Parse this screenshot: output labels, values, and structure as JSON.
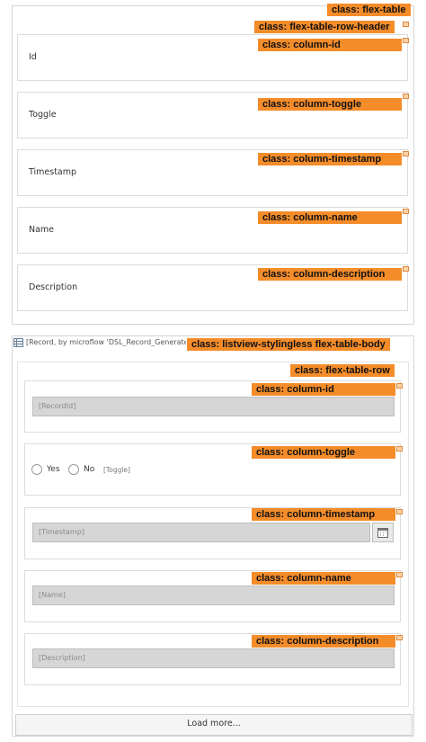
{
  "header_table": {
    "tag": "class: flex-table",
    "row_tag": "class: flex-table-row-header",
    "columns": [
      {
        "label": "Id",
        "tag": "class: column-id"
      },
      {
        "label": "Toggle",
        "tag": "class: column-toggle"
      },
      {
        "label": "Timestamp",
        "tag": "class: column-timestamp"
      },
      {
        "label": "Name",
        "tag": "class: column-name"
      },
      {
        "label": "Description",
        "tag": "class: column-description"
      }
    ]
  },
  "listview": {
    "source_caption": "[Record, by microflow 'DSL_Record_Generate",
    "tag": "class: listview-stylingless flex-table-body",
    "row_tag": "class: flex-table-row",
    "fields": {
      "id": {
        "tag": "class: column-id",
        "placeholder": "[RecordId]"
      },
      "toggle": {
        "tag": "class: column-toggle",
        "yes": "Yes",
        "no": "No",
        "caption": "[Toggle]"
      },
      "timestamp": {
        "tag": "class: column-timestamp",
        "placeholder": "[Timestamp]"
      },
      "name": {
        "tag": "class: column-name",
        "placeholder": "[Name]"
      },
      "description": {
        "tag": "class: column-description",
        "placeholder": "[Description]"
      }
    },
    "load_more": "Load more..."
  }
}
